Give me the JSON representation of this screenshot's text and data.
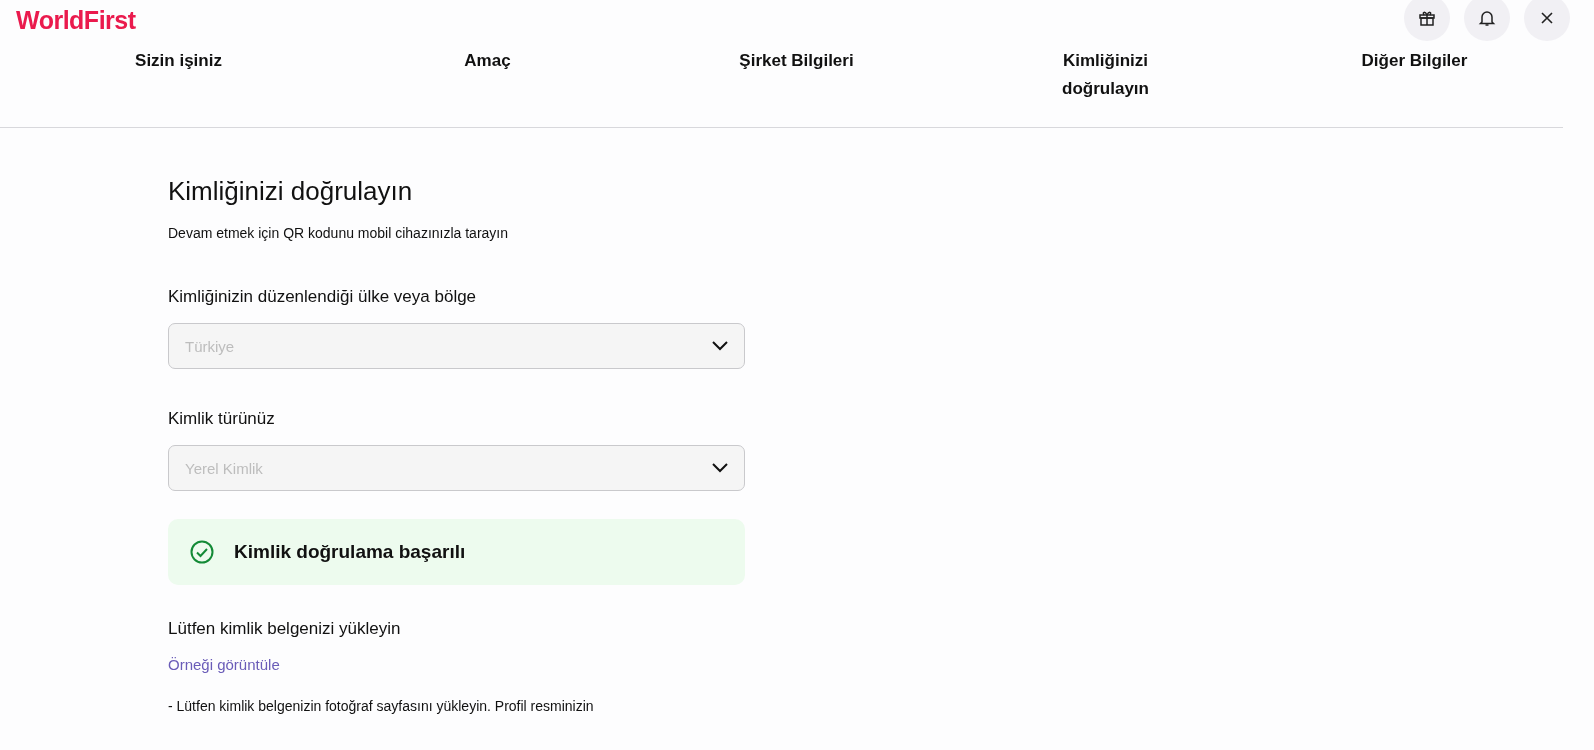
{
  "header": {
    "logo": "WorldFirst",
    "actions": [
      {
        "kind": "gift"
      },
      {
        "kind": "bell"
      },
      {
        "kind": "close"
      }
    ]
  },
  "steps": [
    {
      "label": "Sizin işiniz"
    },
    {
      "label": "Amaç"
    },
    {
      "label": "Şirket Bilgileri"
    },
    {
      "label": "Kimliğinizi doğrulayın"
    },
    {
      "label": "Diğer Bilgiler"
    }
  ],
  "form": {
    "title": "Kimliğinizi doğrulayın",
    "subtitle": "Devam etmek için QR kodunu mobil cihazınızla tarayın",
    "fields": [
      {
        "label": "Kimliğinizin düzenlendiği ülke veya bölge",
        "value": "Türkiye",
        "disabled": true
      },
      {
        "label": "Kimlik türünüz",
        "value": "Yerel Kimlik",
        "disabled": true
      }
    ],
    "status": {
      "text": "Kimlik doğrulama başarılı",
      "kind": "success"
    },
    "upload": {
      "heading": "Lütfen kimlik belgenizi yükleyin",
      "link": "Örneği görüntüle",
      "note": "- Lütfen kimlik belgenizin fotoğraf sayfasını yükleyin. Profil resminizin"
    }
  }
}
